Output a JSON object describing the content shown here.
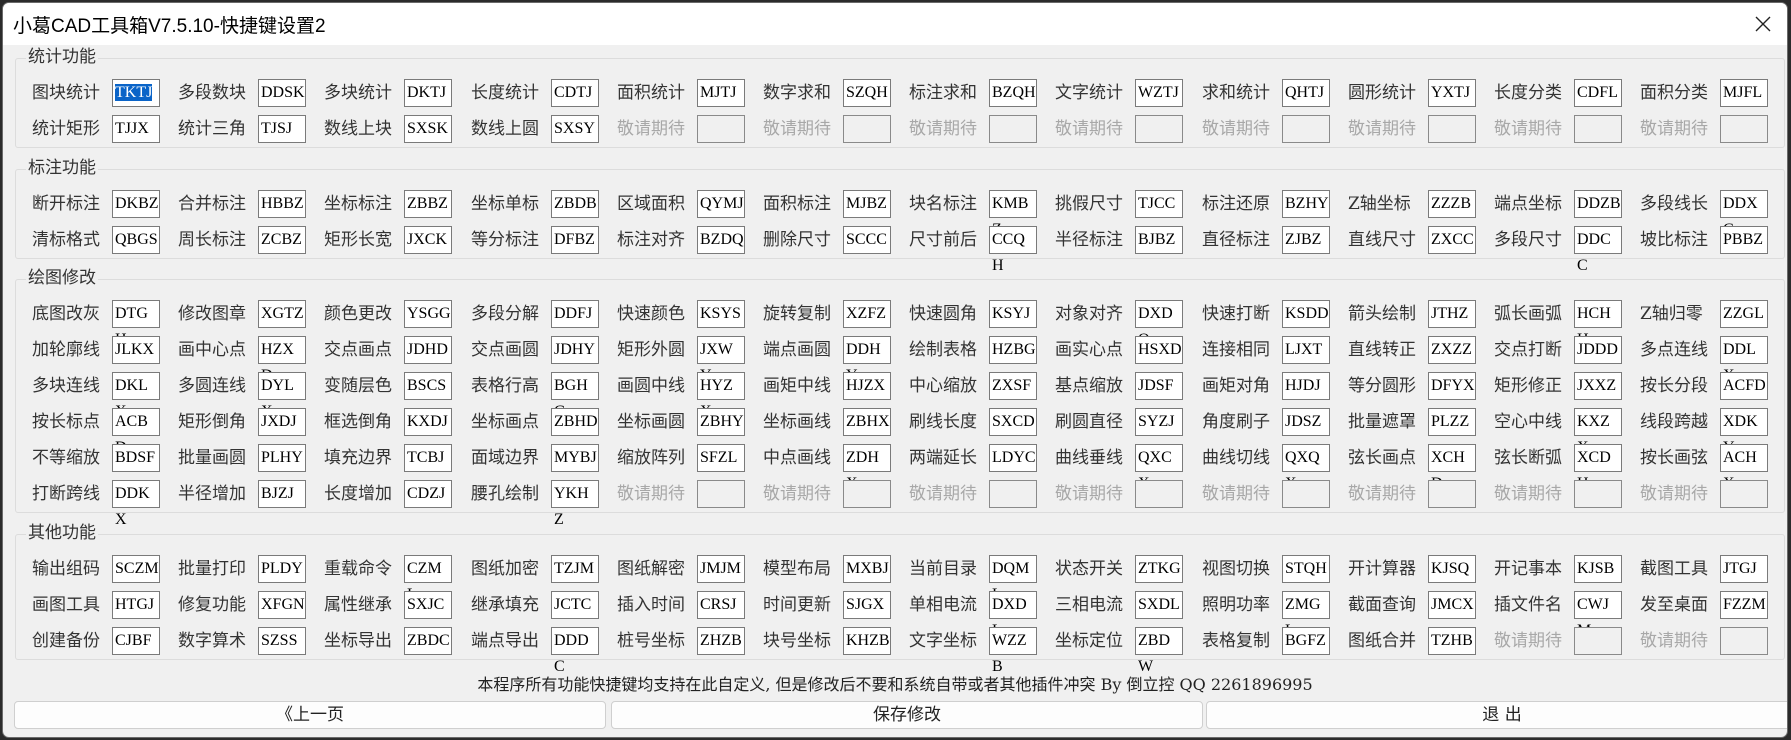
{
  "window": {
    "title": "小葛CAD工具箱V7.5.10-快捷键设置2",
    "close_icon": "close-icon"
  },
  "colors": {
    "selection": "#0a64c8",
    "window_bg": "#f0f0f0",
    "disabled_text": "#a8a8a8"
  },
  "groups": [
    {
      "title": "统计功能",
      "rows": [
        [
          {
            "label": "图块统计",
            "key": "TKTJ",
            "selected": true
          },
          {
            "label": "多段数块",
            "key": "DDSK"
          },
          {
            "label": "多块统计",
            "key": "DKTJ"
          },
          {
            "label": "长度统计",
            "key": "CDTJ"
          },
          {
            "label": "面积统计",
            "key": "MJTJ"
          },
          {
            "label": "数字求和",
            "key": "SZQH"
          },
          {
            "label": "标注求和",
            "key": "BZQH"
          },
          {
            "label": "文字统计",
            "key": "WZTJ"
          },
          {
            "label": "求和统计",
            "key": "QHTJ"
          },
          {
            "label": "圆形统计",
            "key": "YXTJ"
          },
          {
            "label": "长度分类",
            "key": "CDFL"
          },
          {
            "label": "面积分类",
            "key": "MJFL"
          }
        ],
        [
          {
            "label": "统计矩形",
            "key": "TJJX"
          },
          {
            "label": "统计三角",
            "key": "TJSJ"
          },
          {
            "label": "数线上块",
            "key": "SXSK"
          },
          {
            "label": "数线上圆",
            "key": "SXSY"
          },
          {
            "label": "敬请期待",
            "key": "",
            "disabled": true
          },
          {
            "label": "敬请期待",
            "key": "",
            "disabled": true
          },
          {
            "label": "敬请期待",
            "key": "",
            "disabled": true
          },
          {
            "label": "敬请期待",
            "key": "",
            "disabled": true
          },
          {
            "label": "敬请期待",
            "key": "",
            "disabled": true
          },
          {
            "label": "敬请期待",
            "key": "",
            "disabled": true
          },
          {
            "label": "敬请期待",
            "key": "",
            "disabled": true
          },
          {
            "label": "敬请期待",
            "key": "",
            "disabled": true
          }
        ]
      ]
    },
    {
      "title": "标注功能",
      "rows": [
        [
          {
            "label": "断开标注",
            "key": "DKBZ"
          },
          {
            "label": "合并标注",
            "key": "HBBZ"
          },
          {
            "label": "坐标标注",
            "key": "ZBBZ"
          },
          {
            "label": "坐标单标",
            "key": "ZBDB"
          },
          {
            "label": "区域面积",
            "key": "QYMJ"
          },
          {
            "label": "面积标注",
            "key": "MJBZ"
          },
          {
            "label": "块名标注",
            "key": "KMBZ"
          },
          {
            "label": "挑假尺寸",
            "key": "TJCC"
          },
          {
            "label": "标注还原",
            "key": "BZHY"
          },
          {
            "label": "Z轴坐标",
            "key": "ZZZB"
          },
          {
            "label": "端点坐标",
            "key": "DDZB"
          },
          {
            "label": "多段线长",
            "key": "DDXC"
          }
        ],
        [
          {
            "label": "清标格式",
            "key": "QBGS"
          },
          {
            "label": "周长标注",
            "key": "ZCBZ"
          },
          {
            "label": "矩形长宽",
            "key": "JXCK"
          },
          {
            "label": "等分标注",
            "key": "DFBZ"
          },
          {
            "label": "标注对齐",
            "key": "BZDQ"
          },
          {
            "label": "删除尺寸",
            "key": "SCCC"
          },
          {
            "label": "尺寸前后",
            "key": "CCQH"
          },
          {
            "label": "半径标注",
            "key": "BJBZ"
          },
          {
            "label": "直径标注",
            "key": "ZJBZ"
          },
          {
            "label": "直线尺寸",
            "key": "ZXCC"
          },
          {
            "label": "多段尺寸",
            "key": "DDCC"
          },
          {
            "label": "坡比标注",
            "key": "PBBZ"
          }
        ]
      ]
    },
    {
      "title": "绘图修改",
      "rows": [
        [
          {
            "label": "底图改灰",
            "key": "DTGH"
          },
          {
            "label": "修改图章",
            "key": "XGTZ"
          },
          {
            "label": "颜色更改",
            "key": "YSGG"
          },
          {
            "label": "多段分解",
            "key": "DDFJ"
          },
          {
            "label": "快速颜色",
            "key": "KSYS"
          },
          {
            "label": "旋转复制",
            "key": "XZFZ"
          },
          {
            "label": "快速圆角",
            "key": "KSYJ"
          },
          {
            "label": "对象对齐",
            "key": "DXDQ"
          },
          {
            "label": "快速打断",
            "key": "KSDD"
          },
          {
            "label": "箭头绘制",
            "key": "JTHZ"
          },
          {
            "label": "弧长画弧",
            "key": "HCHH"
          },
          {
            "label": "Z轴归零",
            "key": "ZZGL"
          }
        ],
        [
          {
            "label": "加轮廓线",
            "key": "JLKX"
          },
          {
            "label": "画中心点",
            "key": "HZXD"
          },
          {
            "label": "交点画点",
            "key": "JDHD"
          },
          {
            "label": "交点画圆",
            "key": "JDHY"
          },
          {
            "label": "矩形外圆",
            "key": "JXWY"
          },
          {
            "label": "端点画圆",
            "key": "DDHY"
          },
          {
            "label": "绘制表格",
            "key": "HZBG"
          },
          {
            "label": "画实心点",
            "key": "HSXD"
          },
          {
            "label": "连接相同",
            "key": "LJXT"
          },
          {
            "label": "直线转正",
            "key": "ZXZZ"
          },
          {
            "label": "交点打断",
            "key": "JDDD"
          },
          {
            "label": "多点连线",
            "key": "DDLX"
          }
        ],
        [
          {
            "label": "多块连线",
            "key": "DKLX"
          },
          {
            "label": "多圆连线",
            "key": "DYLX"
          },
          {
            "label": "变随层色",
            "key": "BSCS"
          },
          {
            "label": "表格行高",
            "key": "BGHG"
          },
          {
            "label": "画圆中线",
            "key": "HYZX"
          },
          {
            "label": "画矩中线",
            "key": "HJZX"
          },
          {
            "label": "中心缩放",
            "key": "ZXSF"
          },
          {
            "label": "基点缩放",
            "key": "JDSF"
          },
          {
            "label": "画矩对角",
            "key": "HJDJ"
          },
          {
            "label": "等分圆形",
            "key": "DFYX"
          },
          {
            "label": "矩形修正",
            "key": "JXXZ"
          },
          {
            "label": "按长分段",
            "key": "ACFD"
          }
        ],
        [
          {
            "label": "按长标点",
            "key": "ACBD"
          },
          {
            "label": "矩形倒角",
            "key": "JXDJ"
          },
          {
            "label": "框选倒角",
            "key": "KXDJ"
          },
          {
            "label": "坐标画点",
            "key": "ZBHD"
          },
          {
            "label": "坐标画圆",
            "key": "ZBHY"
          },
          {
            "label": "坐标画线",
            "key": "ZBHX"
          },
          {
            "label": "刷线长度",
            "key": "SXCD"
          },
          {
            "label": "刷圆直径",
            "key": "SYZJ"
          },
          {
            "label": "角度刷子",
            "key": "JDSZ"
          },
          {
            "label": "批量遮罩",
            "key": "PLZZ"
          },
          {
            "label": "空心中线",
            "key": "KXZX"
          },
          {
            "label": "线段跨越",
            "key": "XDKY"
          }
        ],
        [
          {
            "label": "不等缩放",
            "key": "BDSF"
          },
          {
            "label": "批量画圆",
            "key": "PLHY"
          },
          {
            "label": "填充边界",
            "key": "TCBJ"
          },
          {
            "label": "面域边界",
            "key": "MYBJ"
          },
          {
            "label": "缩放阵列",
            "key": "SFZL"
          },
          {
            "label": "中点画线",
            "key": "ZDHX"
          },
          {
            "label": "两端延长",
            "key": "LDYC"
          },
          {
            "label": "曲线垂线",
            "key": "QXCX"
          },
          {
            "label": "曲线切线",
            "key": "QXQX"
          },
          {
            "label": "弦长画点",
            "key": "XCHD"
          },
          {
            "label": "弦长断弧",
            "key": "XCDH"
          },
          {
            "label": "按长画弦",
            "key": "ACHX"
          }
        ],
        [
          {
            "label": "打断跨线",
            "key": "DDKX"
          },
          {
            "label": "半径增加",
            "key": "BJZJ"
          },
          {
            "label": "长度增加",
            "key": "CDZJ"
          },
          {
            "label": "腰孔绘制",
            "key": "YKHZ"
          },
          {
            "label": "敬请期待",
            "key": "",
            "disabled": true
          },
          {
            "label": "敬请期待",
            "key": "",
            "disabled": true
          },
          {
            "label": "敬请期待",
            "key": "",
            "disabled": true
          },
          {
            "label": "敬请期待",
            "key": "",
            "disabled": true
          },
          {
            "label": "敬请期待",
            "key": "",
            "disabled": true
          },
          {
            "label": "敬请期待",
            "key": "",
            "disabled": true
          },
          {
            "label": "敬请期待",
            "key": "",
            "disabled": true
          },
          {
            "label": "敬请期待",
            "key": "",
            "disabled": true
          }
        ]
      ]
    },
    {
      "title": "其他功能",
      "rows": [
        [
          {
            "label": "输出组码",
            "key": "SCZM"
          },
          {
            "label": "批量打印",
            "key": "PLDY"
          },
          {
            "label": "重载命令",
            "key": "CZML"
          },
          {
            "label": "图纸加密",
            "key": "TZJM"
          },
          {
            "label": "图纸解密",
            "key": "JMJM"
          },
          {
            "label": "模型布局",
            "key": "MXBJ"
          },
          {
            "label": "当前目录",
            "key": "DQML"
          },
          {
            "label": "状态开关",
            "key": "ZTKG"
          },
          {
            "label": "视图切换",
            "key": "STQH"
          },
          {
            "label": "开计算器",
            "key": "KJSQ"
          },
          {
            "label": "开记事本",
            "key": "KJSB"
          },
          {
            "label": "截图工具",
            "key": "JTGJ"
          }
        ],
        [
          {
            "label": "画图工具",
            "key": "HTGJ"
          },
          {
            "label": "修复功能",
            "key": "XFGN"
          },
          {
            "label": "属性继承",
            "key": "SXJC"
          },
          {
            "label": "继承填充",
            "key": "JCTC"
          },
          {
            "label": "插入时间",
            "key": "CRSJ"
          },
          {
            "label": "时间更新",
            "key": "SJGX"
          },
          {
            "label": "单相电流",
            "key": "DXDL"
          },
          {
            "label": "三相电流",
            "key": "SXDL"
          },
          {
            "label": "照明功率",
            "key": "ZMGL"
          },
          {
            "label": "截面查询",
            "key": "JMCX"
          },
          {
            "label": "插文件名",
            "key": "CWJM"
          },
          {
            "label": "发至桌面",
            "key": "FZZM"
          }
        ],
        [
          {
            "label": "创建备份",
            "key": "CJBF"
          },
          {
            "label": "数字算术",
            "key": "SZSS"
          },
          {
            "label": "坐标导出",
            "key": "ZBDC"
          },
          {
            "label": "端点导出",
            "key": "DDDC"
          },
          {
            "label": "桩号坐标",
            "key": "ZHZB"
          },
          {
            "label": "块号坐标",
            "key": "KHZB"
          },
          {
            "label": "文字坐标",
            "key": "WZZB"
          },
          {
            "label": "坐标定位",
            "key": "ZBDW"
          },
          {
            "label": "表格复制",
            "key": "BGFZ"
          },
          {
            "label": "图纸合并",
            "key": "TZHB"
          },
          {
            "label": "敬请期待",
            "key": "",
            "disabled": true
          },
          {
            "label": "敬请期待",
            "key": "",
            "disabled": true
          }
        ]
      ]
    }
  ],
  "footer": {
    "note": "本程序所有功能快捷键均支持在此自定义, 但是修改后不要和系统自带或者其他插件冲突  By 倒立控 QQ 2261896995",
    "buttons": {
      "prev": "《上一页",
      "save": "保存修改",
      "exit": "退  出"
    }
  }
}
